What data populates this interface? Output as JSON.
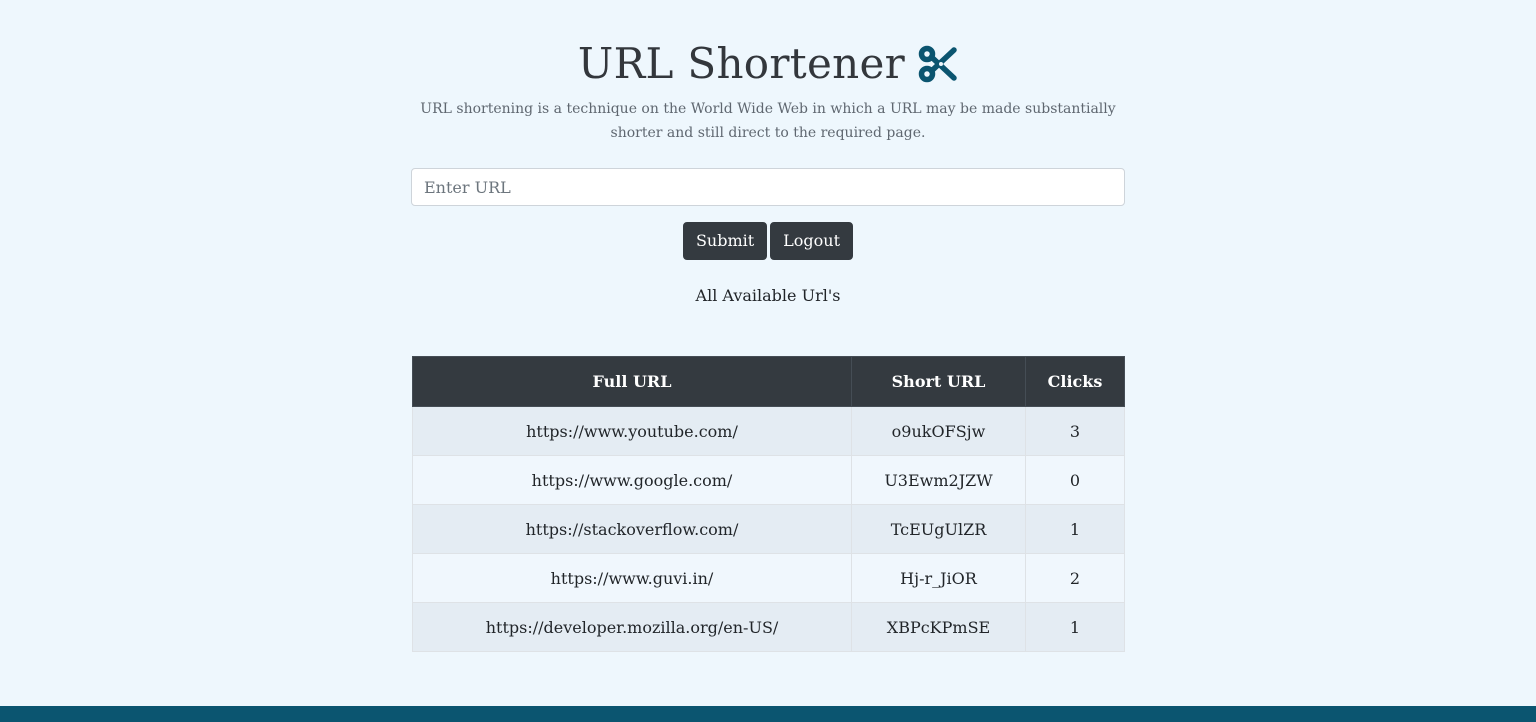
{
  "header": {
    "title": "URL Shortener",
    "icon": "scissors-icon",
    "subtitle": "URL shortening is a technique on the World Wide Web in which a URL may be made substantially shorter and still direct to the required page."
  },
  "form": {
    "url_placeholder": "Enter URL",
    "url_value": "",
    "submit_label": "Submit",
    "logout_label": "Logout"
  },
  "list": {
    "heading": "All Available Url's",
    "columns": [
      "Full URL",
      "Short URL",
      "Clicks"
    ],
    "rows": [
      {
        "full_url": "https://www.youtube.com/",
        "short_url": "o9ukOFSjw",
        "clicks": "3"
      },
      {
        "full_url": "https://www.google.com/",
        "short_url": "U3Ewm2JZW",
        "clicks": "0"
      },
      {
        "full_url": "https://stackoverflow.com/",
        "short_url": "TcEUgUlZR",
        "clicks": "1"
      },
      {
        "full_url": "https://www.guvi.in/",
        "short_url": "Hj-r_JiOR",
        "clicks": "2"
      },
      {
        "full_url": "https://developer.mozilla.org/en-US/",
        "short_url": "XBPcKPmSE",
        "clicks": "1"
      }
    ]
  },
  "colors": {
    "background": "#eef7fd",
    "button": "#343a40",
    "accent": "#0b5570",
    "icon": "#0b5570"
  }
}
